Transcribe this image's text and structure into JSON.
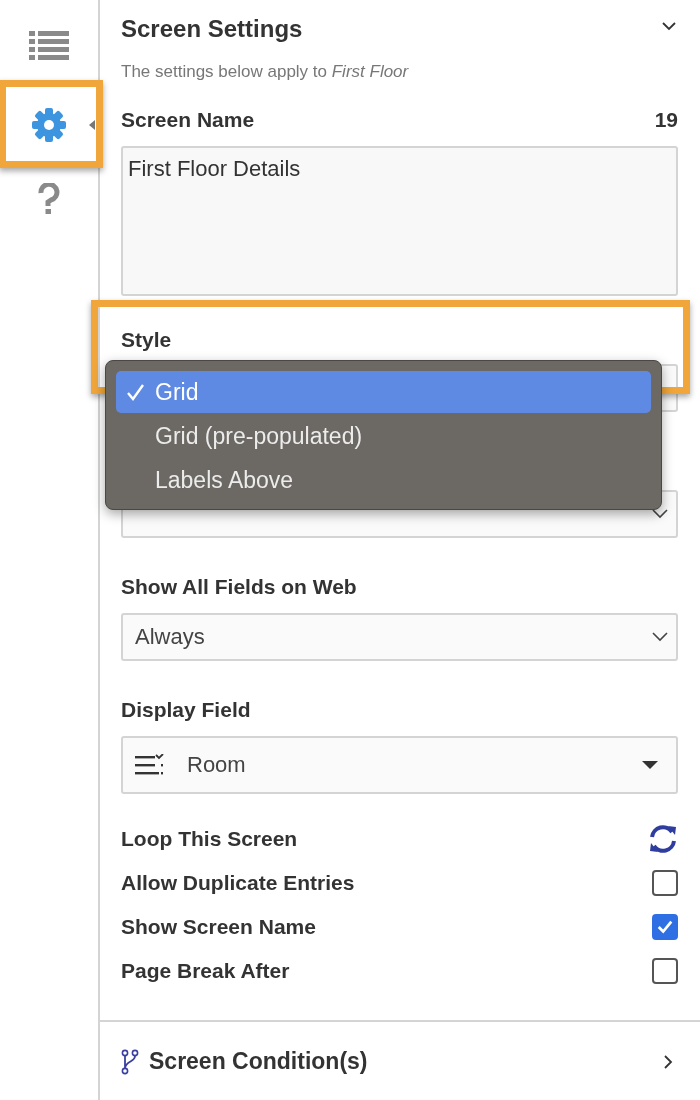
{
  "rail": {
    "items": [
      {
        "kind": "list",
        "selected": false,
        "highlighted": false
      },
      {
        "kind": "gear",
        "selected": true,
        "highlighted": true
      },
      {
        "kind": "help",
        "selected": false,
        "highlighted": false
      }
    ]
  },
  "panel": {
    "title": "Screen Settings",
    "expanded": true,
    "subtitle": "The settings below apply to *First Floor*",
    "screen_name": {
      "label": "Screen Name",
      "count": "19",
      "value": "First Floor Details"
    },
    "style": {
      "label": "Style",
      "highlighted": true,
      "options": [
        {
          "label": "Grid",
          "selected": true
        },
        {
          "label": "Grid (pre-populated)",
          "selected": false
        },
        {
          "label": "Labels Above",
          "selected": false
        }
      ]
    },
    "show_all_fields": {
      "label": "Show All Fields on Web",
      "value": "Always"
    },
    "display_field": {
      "label": "Display Field",
      "value": "Room"
    },
    "options": [
      {
        "kind": "loop",
        "label": "Loop This Screen"
      },
      {
        "kind": "checkbox",
        "label": "Allow Duplicate Entries",
        "checked": false
      },
      {
        "kind": "checkbox",
        "label": "Show Screen Name",
        "checked": true
      },
      {
        "kind": "checkbox",
        "label": "Page Break After",
        "checked": false
      }
    ],
    "footer": {
      "label": "Screen Condition(s)",
      "expanded": false
    }
  }
}
